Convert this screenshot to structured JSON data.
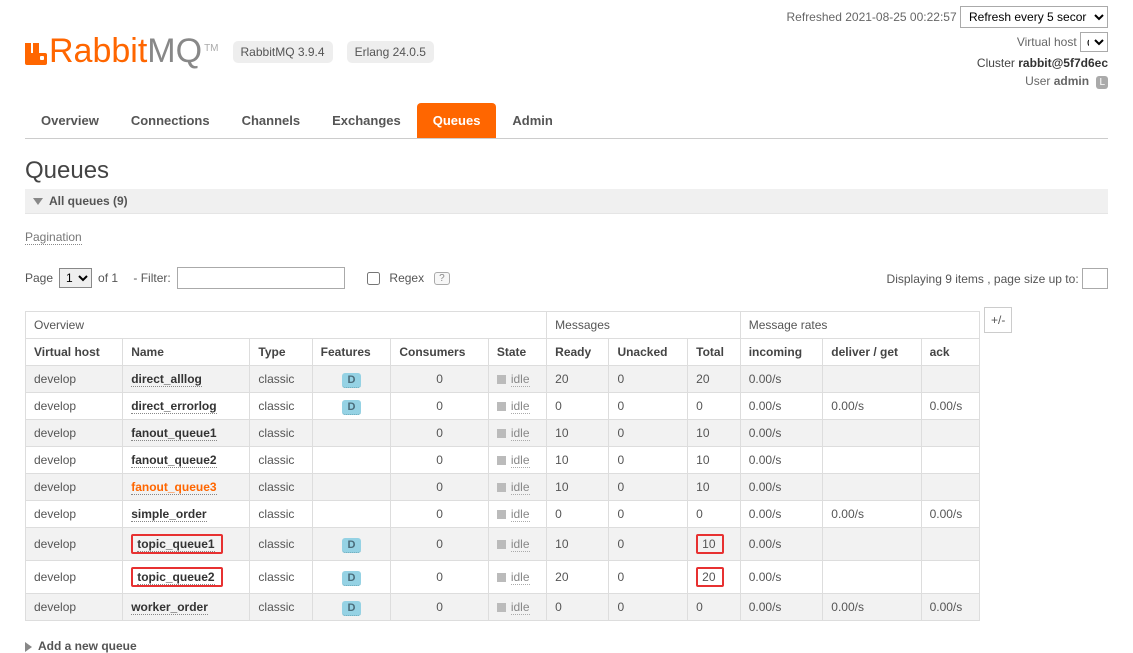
{
  "header": {
    "brand_rabbit": "Rabbit",
    "brand_mq": "MQ",
    "tm": "TM",
    "version_rabbit": "RabbitMQ 3.9.4",
    "version_erlang": "Erlang 24.0.5",
    "refreshed": "Refreshed 2021-08-25 00:22:57",
    "refresh_option": "Refresh every 5 secor",
    "vhost_label": "Virtual host",
    "vhost_value": "deve",
    "cluster_label": "Cluster",
    "cluster_value": "rabbit@5f7d6ec",
    "user_label": "User",
    "user_value": "admin",
    "user_badge": "L"
  },
  "tabs": [
    "Overview",
    "Connections",
    "Channels",
    "Exchanges",
    "Queues",
    "Admin"
  ],
  "page_title": "Queues",
  "subheader": "All queues (9)",
  "pagination": {
    "section": "Pagination",
    "page_label": "Page",
    "page_value": "1",
    "of_label": "of 1",
    "filter_label": "- Filter:",
    "filter_value": "",
    "regex_label": "Regex",
    "display_label": "Displaying 9 items , page size up to:",
    "page_size": ""
  },
  "groups": {
    "overview": "Overview",
    "messages": "Messages",
    "rates": "Message rates",
    "plusminus": "+/-"
  },
  "columns": {
    "vhost": "Virtual host",
    "name": "Name",
    "type": "Type",
    "features": "Features",
    "consumers": "Consumers",
    "state": "State",
    "ready": "Ready",
    "unacked": "Unacked",
    "total": "Total",
    "incoming": "incoming",
    "deliver": "deliver / get",
    "ack": "ack"
  },
  "rows": [
    {
      "vh": "develop",
      "name": "direct_alllog",
      "type": "classic",
      "feat": "D",
      "cons": "0",
      "state": "idle",
      "ready": "20",
      "un": "0",
      "total": "20",
      "in": "0.00/s",
      "del": "",
      "ack": "",
      "hl": false,
      "rb_name": false,
      "rb_total": false
    },
    {
      "vh": "develop",
      "name": "direct_errorlog",
      "type": "classic",
      "feat": "D",
      "cons": "0",
      "state": "idle",
      "ready": "0",
      "un": "0",
      "total": "0",
      "in": "0.00/s",
      "del": "0.00/s",
      "ack": "0.00/s",
      "hl": false,
      "rb_name": false,
      "rb_total": false
    },
    {
      "vh": "develop",
      "name": "fanout_queue1",
      "type": "classic",
      "feat": "",
      "cons": "0",
      "state": "idle",
      "ready": "10",
      "un": "0",
      "total": "10",
      "in": "0.00/s",
      "del": "",
      "ack": "",
      "hl": false,
      "rb_name": false,
      "rb_total": false
    },
    {
      "vh": "develop",
      "name": "fanout_queue2",
      "type": "classic",
      "feat": "",
      "cons": "0",
      "state": "idle",
      "ready": "10",
      "un": "0",
      "total": "10",
      "in": "0.00/s",
      "del": "",
      "ack": "",
      "hl": false,
      "rb_name": false,
      "rb_total": false
    },
    {
      "vh": "develop",
      "name": "fanout_queue3",
      "type": "classic",
      "feat": "",
      "cons": "0",
      "state": "idle",
      "ready": "10",
      "un": "0",
      "total": "10",
      "in": "0.00/s",
      "del": "",
      "ack": "",
      "hl": true,
      "rb_name": false,
      "rb_total": false
    },
    {
      "vh": "develop",
      "name": "simple_order",
      "type": "classic",
      "feat": "",
      "cons": "0",
      "state": "idle",
      "ready": "0",
      "un": "0",
      "total": "0",
      "in": "0.00/s",
      "del": "0.00/s",
      "ack": "0.00/s",
      "hl": false,
      "rb_name": false,
      "rb_total": false
    },
    {
      "vh": "develop",
      "name": "topic_queue1",
      "type": "classic",
      "feat": "D",
      "cons": "0",
      "state": "idle",
      "ready": "10",
      "un": "0",
      "total": "10",
      "in": "0.00/s",
      "del": "",
      "ack": "",
      "hl": false,
      "rb_name": true,
      "rb_total": true
    },
    {
      "vh": "develop",
      "name": "topic_queue2",
      "type": "classic",
      "feat": "D",
      "cons": "0",
      "state": "idle",
      "ready": "20",
      "un": "0",
      "total": "20",
      "in": "0.00/s",
      "del": "",
      "ack": "",
      "hl": false,
      "rb_name": true,
      "rb_total": true
    },
    {
      "vh": "develop",
      "name": "worker_order",
      "type": "classic",
      "feat": "D",
      "cons": "0",
      "state": "idle",
      "ready": "0",
      "un": "0",
      "total": "0",
      "in": "0.00/s",
      "del": "0.00/s",
      "ack": "0.00/s",
      "hl": false,
      "rb_name": false,
      "rb_total": false
    }
  ],
  "footer": {
    "add": "Add a new queue"
  }
}
